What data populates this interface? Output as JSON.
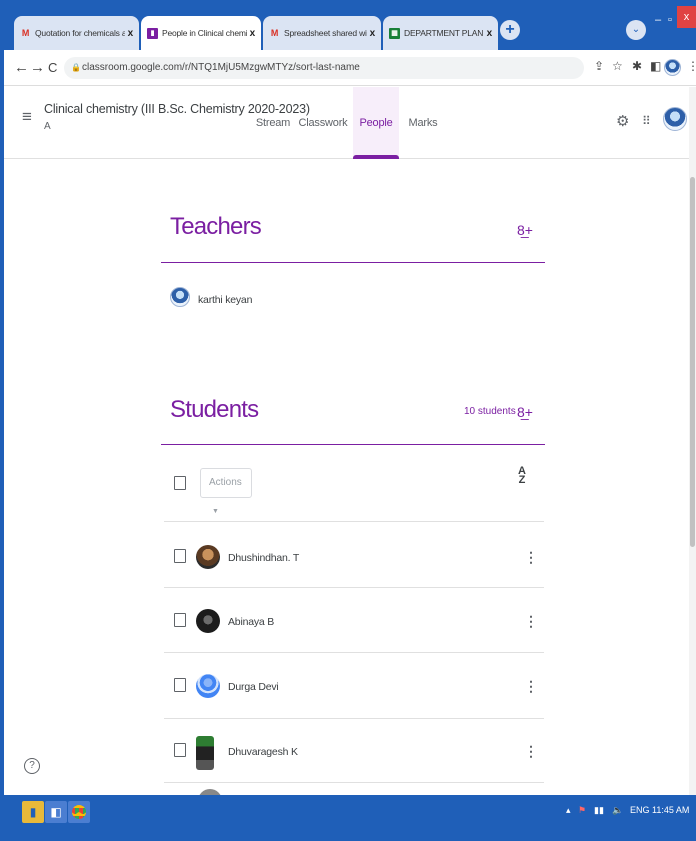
{
  "browser": {
    "tabs": [
      {
        "title": "Quotation for chemicals and gla",
        "icon": "gmail-icon",
        "active": false
      },
      {
        "title": "People in Clinical chemistry (III B.",
        "icon": "classroom-icon",
        "active": true
      },
      {
        "title": "Spreadsheet shared with you: \"D",
        "icon": "gmail-icon",
        "active": false
      },
      {
        "title": "DEPARTMENT PLAN FOR PRESE",
        "icon": "sheets-icon",
        "active": false
      }
    ],
    "close_glyph": "x",
    "new_tab_glyph": "+",
    "url": "classroom.google.com/r/NTQ1MjU5MzgwMTYz/sort-last-name"
  },
  "classroom": {
    "class_name": "Clinical chemistry (III B.Sc. Chemistry 2020-2023)",
    "section": "A",
    "tabs": [
      "Stream",
      "Classwork",
      "People",
      "Marks"
    ],
    "active_tab": "People"
  },
  "teachers": {
    "heading": "Teachers",
    "list": [
      {
        "name": "karthi keyan"
      }
    ]
  },
  "students": {
    "heading": "Students",
    "count_label": "10 students",
    "actions_label": "Actions",
    "sort_label_top": "A",
    "sort_label_bottom": "Z",
    "list": [
      {
        "name": "Dhushindhan. T",
        "avatar": "photo-man"
      },
      {
        "name": "Abinaya B",
        "avatar": "photo-dark"
      },
      {
        "name": "Durga Devi",
        "avatar": "default-blue"
      },
      {
        "name": "Dhuvaragesh K",
        "avatar": "photo-standing"
      }
    ]
  },
  "help_glyph": "?",
  "taskbar": {
    "language": "ENG",
    "time": "11:45 AM"
  },
  "colors": {
    "accent": "#7b1fa2",
    "titlebar": "#1f5fb8"
  }
}
